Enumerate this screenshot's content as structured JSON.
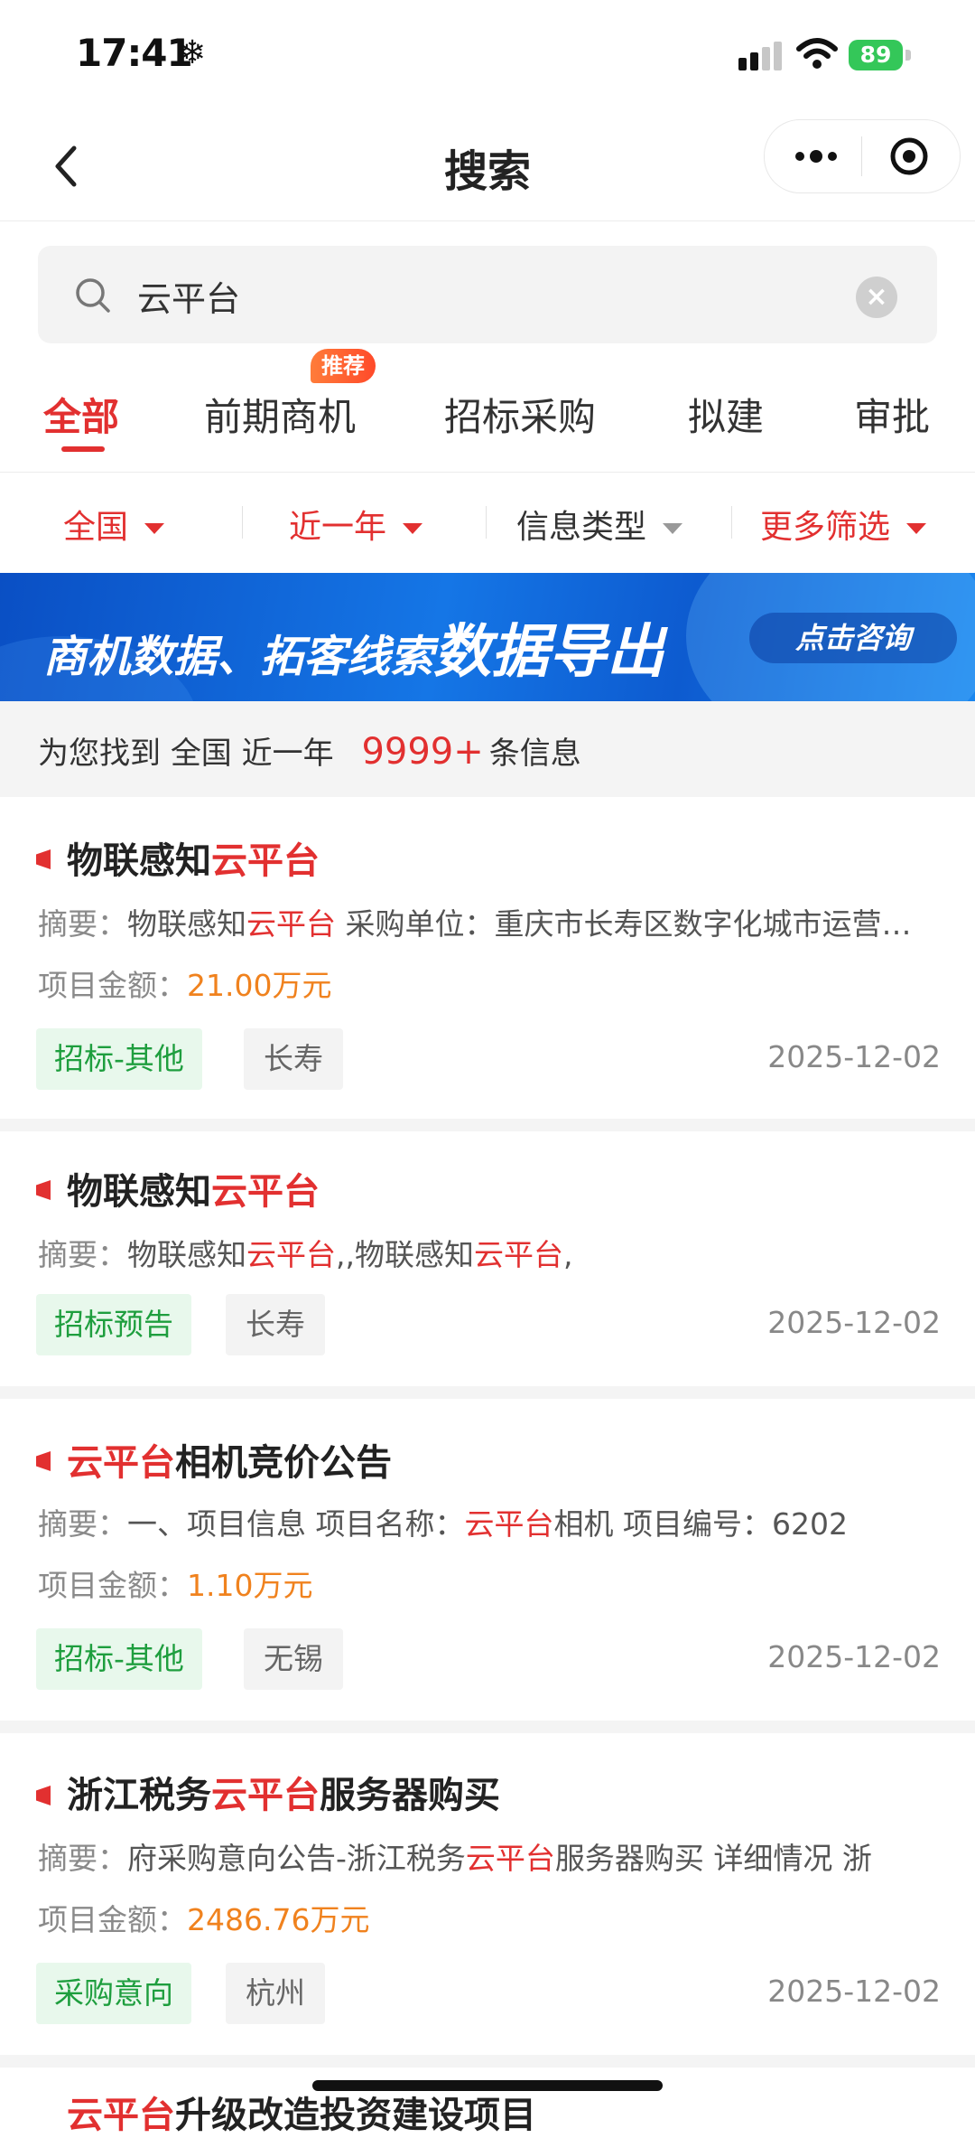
{
  "status_bar": {
    "time": "17:41",
    "snow": "❄",
    "battery": "89"
  },
  "nav": {
    "title": "搜索"
  },
  "search": {
    "query": "云平台"
  },
  "tabs": [
    {
      "label": "全部"
    },
    {
      "label": "前期商机",
      "badge": "推荐"
    },
    {
      "label": "招标采购"
    },
    {
      "label": "拟建"
    },
    {
      "label": "审批"
    }
  ],
  "filters": [
    {
      "label": "全国"
    },
    {
      "label": "近一年"
    },
    {
      "label": "信息类型"
    },
    {
      "label": "更多筛选"
    }
  ],
  "banner": {
    "text_a": "商机数据、拓客线索",
    "text_b": "数据导出",
    "button": "点击咨询"
  },
  "summary": {
    "prefix": "为您找到",
    "region": "全国",
    "period": "近一年",
    "count": "9999+",
    "suffix": "条信息"
  },
  "labels": {
    "abstract": "摘要：",
    "amount": "项目金额："
  },
  "results": [
    {
      "title_pre": "物联感知",
      "title_hl": "云平台",
      "title_post": "",
      "abs_1": "物联感知",
      "abs_hl1": "云平台",
      "abs_2": " 采购单位：重庆市长寿区数字化城市运营管理中心",
      "abs_hl2": "",
      "abs_3": "",
      "amount": "21.00万元",
      "type": "招标-其他",
      "city": "长寿",
      "date": "2025-12-02"
    },
    {
      "title_pre": "物联感知",
      "title_hl": "云平台",
      "title_post": "",
      "abs_1": "物联感知",
      "abs_hl1": "云平台",
      "abs_2": ",,物联感知",
      "abs_hl2": "云平台",
      "abs_3": ",",
      "type": "招标预告",
      "city": "长寿",
      "date": "2025-12-02"
    },
    {
      "title_pre": "",
      "title_hl": "云平台",
      "title_post": "相机竞价公告",
      "abs_1": "一、项目信息 项目名称：",
      "abs_hl1": "云平台",
      "abs_2": "相机 项目编号：6202",
      "abs_hl2": "",
      "abs_3": "",
      "amount": "1.10万元",
      "type": "招标-其他",
      "city": "无锡",
      "date": "2025-12-02"
    },
    {
      "title_pre": "浙江税务",
      "title_hl": "云平台",
      "title_post": "服务器购买",
      "abs_1": "府采购意向公告-浙江税务",
      "abs_hl1": "云平台",
      "abs_2": "服务器购买 详细情况 浙",
      "abs_hl2": "",
      "abs_3": "",
      "amount": "2486.76万元",
      "type": "采购意向",
      "city": "杭州",
      "date": "2025-12-02"
    }
  ],
  "next_result": {
    "title_hl": "云平台",
    "title_post": "升级改造投资建设项目"
  },
  "colors": {
    "accent": "#e23030",
    "amount": "#f0821e",
    "tag_green": "#1e9e3e",
    "banner_blue": "#1576e6"
  }
}
